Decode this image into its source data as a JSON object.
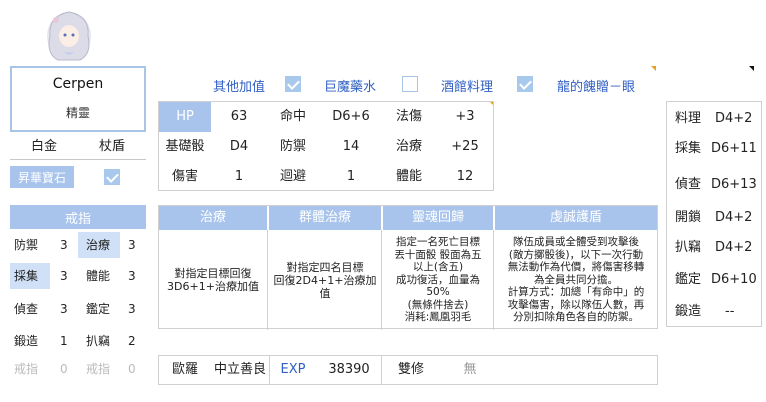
{
  "character": {
    "name": "Cerpen",
    "race": "精靈",
    "class_main": "白金",
    "class_sub": "杖盾",
    "gem_label": "昇華寶石",
    "gem_checked": true
  },
  "bonus_bar": {
    "label": "其他加值",
    "giant_potion": {
      "label": "巨魔藥水",
      "checked": true
    },
    "tavern": {
      "label": "酒館料理",
      "checked": false
    },
    "dragon_gift": {
      "label": "龍的餽贈－眼",
      "checked": true
    }
  },
  "stats": {
    "hp_label": "HP",
    "hp": "63",
    "hit_label": "命中",
    "hit": "D6+6",
    "spell_label": "法傷",
    "spell": "+3",
    "base_dice_label": "基礎骰",
    "base_dice": "D4",
    "defense_label": "防禦",
    "defense": "14",
    "heal_label": "治療",
    "heal": "+25",
    "damage_label": "傷害",
    "damage": "1",
    "evade_label": "迴避",
    "evade": "1",
    "stamina_label": "體能",
    "stamina": "12"
  },
  "skills": [
    {
      "name": "治療",
      "desc": "對指定目標回復\n3D6+1+治療加值"
    },
    {
      "name": "群體治療",
      "desc": "對指定四名目標\n回復2D4+1+治療加\n值"
    },
    {
      "name": "靈魂回歸",
      "desc": "指定一名死亡目標\n丟十面骰 骰面為五\n以上(含五)\n成功復活，血量為\n50%\n(無條件捨去)\n消耗:鳳凰羽毛"
    },
    {
      "name": "虔誠護盾",
      "desc": "隊伍成員或全體受到攻擊後\n(敵方擲骰後)，以下一次行動\n無法動作為代價，將傷害移轉\n為全員共同分擔。\n計算方式：加總「有命中」的\n攻擊傷害，除以隊伍人數，再\n分別扣除角色各自的防禦。"
    }
  ],
  "info_bar": {
    "deity": "歐羅",
    "alignment": "中立善良",
    "exp_label": "EXP",
    "exp": "38390",
    "dual_label": "雙修",
    "dual": "無"
  },
  "rings": {
    "header": "戒指",
    "items": [
      {
        "label": "防禦",
        "value": "3"
      },
      {
        "label": "治療",
        "value": "3"
      },
      {
        "label": "採集",
        "value": "3"
      },
      {
        "label": "體能",
        "value": "3"
      },
      {
        "label": "偵查",
        "value": "3"
      },
      {
        "label": "鑑定",
        "value": "3"
      },
      {
        "label": "鍛造",
        "value": "1"
      },
      {
        "label": "扒竊",
        "value": "2"
      },
      {
        "label": "戒指",
        "value": "0"
      },
      {
        "label": "戒指",
        "value": "0"
      }
    ]
  },
  "life_skills": [
    {
      "label": "料理",
      "value": "D4+2"
    },
    {
      "label": "採集",
      "value": "D6+11"
    },
    {
      "label": "偵查",
      "value": "D6+13"
    },
    {
      "label": "開鎖",
      "value": "D4+2"
    },
    {
      "label": "扒竊",
      "value": "D4+2"
    },
    {
      "label": "鑑定",
      "value": "D6+10"
    },
    {
      "label": "鍛造",
      "value": "--"
    }
  ],
  "colors": {
    "accent": "#a8c4ec",
    "link": "#2f5fc4"
  }
}
